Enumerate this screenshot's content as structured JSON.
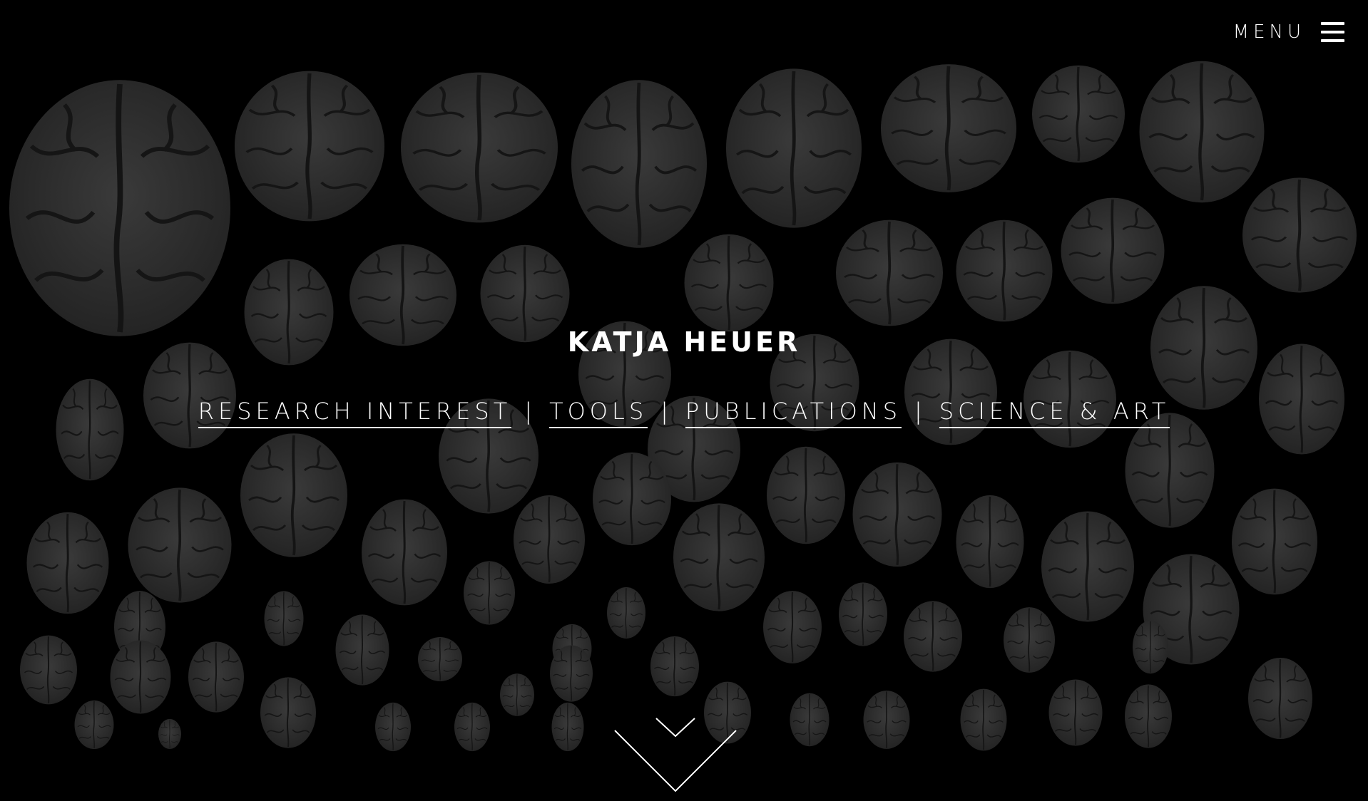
{
  "menu": {
    "label": "MENU",
    "icon": "hamburger-icon"
  },
  "hero": {
    "title": "KATJA HEUER",
    "background": "brain-collection-image"
  },
  "nav": {
    "items": [
      {
        "label": "RESEARCH INTEREST"
      },
      {
        "label": "TOOLS"
      },
      {
        "label": "PUBLICATIONS"
      },
      {
        "label": "SCIENCE & ART"
      }
    ],
    "separator": "|"
  },
  "scroll": {
    "icon": "chevron-down-icon"
  },
  "colors": {
    "background": "#000000",
    "text": "#ffffff",
    "brain_fill": "#2c2c2c"
  }
}
